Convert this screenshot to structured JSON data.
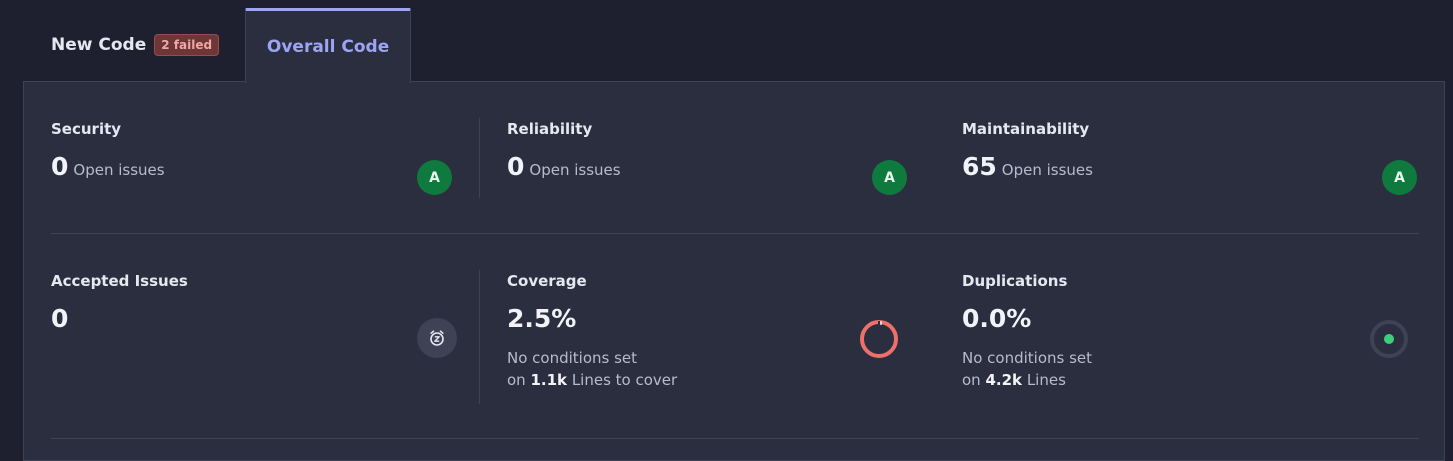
{
  "tabs": {
    "new_code": {
      "label": "New Code",
      "badge": "2 failed"
    },
    "overall_code": {
      "label": "Overall Code"
    }
  },
  "metrics": {
    "security": {
      "title": "Security",
      "value": "0",
      "suffix": "Open issues",
      "rating": "A"
    },
    "reliability": {
      "title": "Reliability",
      "value": "0",
      "suffix": "Open issues",
      "rating": "A"
    },
    "maintainability": {
      "title": "Maintainability",
      "value": "65",
      "suffix": "Open issues",
      "rating": "A"
    },
    "accepted": {
      "title": "Accepted Issues",
      "value": "0"
    },
    "coverage": {
      "title": "Coverage",
      "value": "2.5%",
      "note_line1": "No conditions set",
      "note_prefix": "on",
      "note_amount": "1.1k",
      "note_suffix": "Lines to cover",
      "percent": 2.5
    },
    "duplications": {
      "title": "Duplications",
      "value": "0.0%",
      "note_line1": "No conditions set",
      "note_prefix": "on",
      "note_amount": "4.2k",
      "note_suffix": "Lines",
      "percent": 0.0
    }
  },
  "colors": {
    "accent": "#9da4f4",
    "rating_a": "#0e7a3e",
    "coverage_ring": "#ef6f6a",
    "duplication_dot": "#3ad17a",
    "failed_badge": "#6e3737"
  },
  "icons": {
    "accepted": "snooze-clock-icon",
    "coverage": "coverage-donut-icon",
    "duplications": "duplication-dot-icon"
  }
}
